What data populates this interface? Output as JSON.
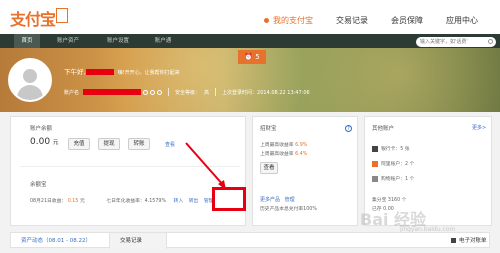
{
  "header": {
    "logo": "支付宝",
    "nav": [
      {
        "label": "我的支付宝"
      },
      {
        "label": "交易记录"
      },
      {
        "label": "会员保障"
      },
      {
        "label": "应用中心"
      }
    ]
  },
  "subnav": {
    "tabs": [
      "首页",
      "账户资产",
      "账户设置",
      "账户通"
    ],
    "search_placeholder": "输入关键字，如'话费'"
  },
  "hero": {
    "alarm_count": "5",
    "greeting": "下午好,",
    "greeting_sub": "嗨!开开心，让我帮你打起来",
    "account_label": "账户名",
    "security_label": "安全等级：",
    "security_value": "高",
    "last_login": "上次登录时间：2014.08.22 13:47:06"
  },
  "balance_card": {
    "title": "账户余额",
    "amount": "0.00",
    "unit": "元",
    "buttons": [
      "充值",
      "提现",
      "转账"
    ],
    "view_link": "查看"
  },
  "yuebao": {
    "title": "余额宝",
    "date_label": "08月21日收益：",
    "income": "0.15",
    "income_unit": "元",
    "rate_label": "七日年化收益率：4.1579%",
    "actions": [
      "转入",
      "转出",
      "管理"
    ]
  },
  "zhaocai_card": {
    "title": "招财宝",
    "line1_label": "上周最高收益率",
    "line1_value": "6.9%",
    "line2_label": "上周最高收益率",
    "line2_value": "6.4%",
    "help_icon": "?",
    "btn_view": "查看",
    "more_link": "更多产品",
    "manage_link": "管理",
    "note": "历史产品本息兑付率100%"
  },
  "other_accounts": {
    "title": "其他账户",
    "more": "更多>",
    "items": [
      {
        "icon": "bank-card-icon",
        "label": "银行卡：5 张"
      },
      {
        "icon": "flower-icon",
        "label": "阿里账户：2 个"
      },
      {
        "icon": "shop-icon",
        "label": "购物账户：1 个"
      }
    ],
    "points_label": "集分宝 3160 个",
    "points_sub": "已存 0.00"
  },
  "bottom": {
    "tab_assets": "资产动态（08.01 - 08.22）",
    "tab_trades": "交易记录",
    "ebill": "电子对账单"
  },
  "watermark": "Bai 经验",
  "watermark_sub": "jingyan.baidu.com",
  "colors": {
    "accent": "#e8712b",
    "red": "#e60012",
    "link": "#3a6ec2",
    "subbar": "#2d3b35"
  }
}
